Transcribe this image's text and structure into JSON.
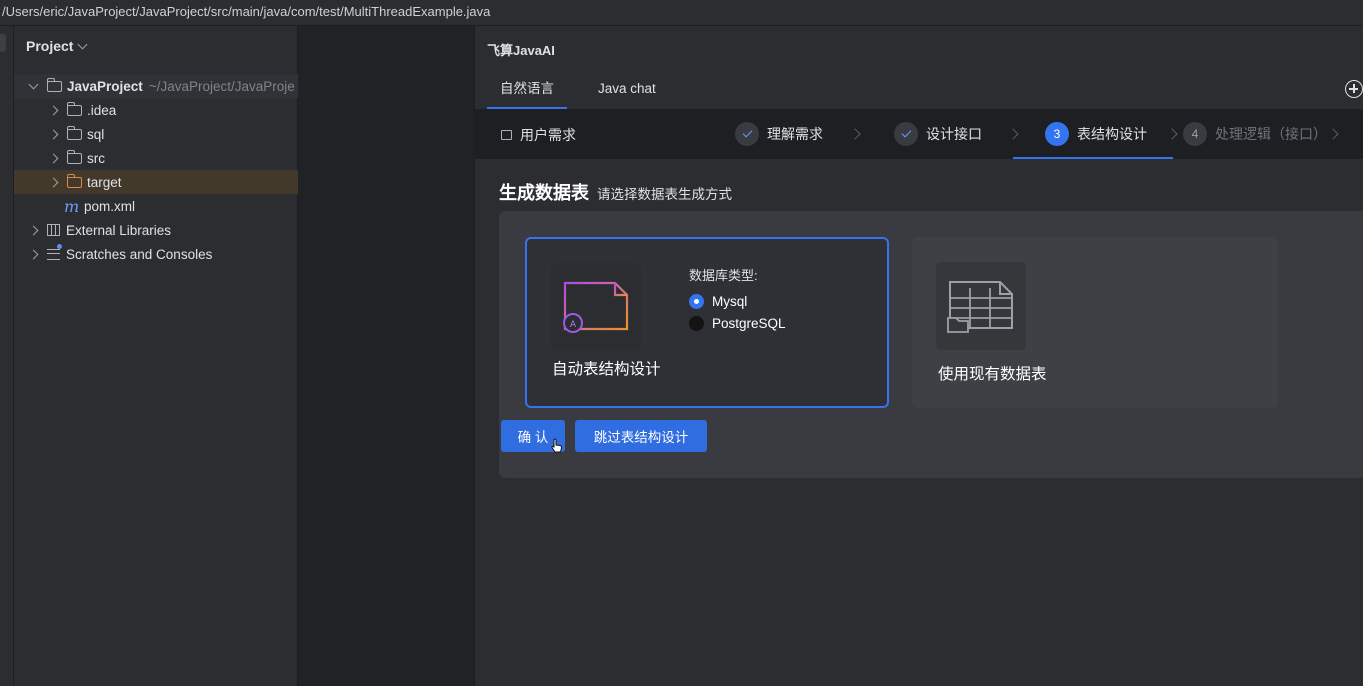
{
  "window": {
    "path": "/Users/eric/JavaProject/JavaProject/src/main/java/com/test/MultiThreadExample.java"
  },
  "project_panel": {
    "title": "Project",
    "tree": [
      {
        "label": "JavaProject",
        "hint": "~/JavaProject/JavaProje",
        "level": 0,
        "expanded": true,
        "icon": "project-folder-icon"
      },
      {
        "label": ".idea",
        "level": 1,
        "icon": "folder-icon"
      },
      {
        "label": "sql",
        "level": 1,
        "icon": "folder-icon"
      },
      {
        "label": "src",
        "level": 1,
        "icon": "folder-icon"
      },
      {
        "label": "target",
        "level": 1,
        "icon": "orange-folder-icon",
        "selected": true
      },
      {
        "label": "pom.xml",
        "level": 1,
        "icon": "maven-icon"
      },
      {
        "label": "External Libraries",
        "level": 0,
        "icon": "library-icon"
      },
      {
        "label": "Scratches and Consoles",
        "level": 0,
        "icon": "scratches-icon"
      }
    ]
  },
  "ai_panel": {
    "title": "飞算JavaAI",
    "tabs": [
      {
        "label": "自然语言",
        "active": true
      },
      {
        "label": "Java chat",
        "active": false
      }
    ],
    "steps": {
      "requirement": "用户需求",
      "items": [
        {
          "label": "理解需求",
          "state": "done",
          "num": ""
        },
        {
          "label": "设计接口",
          "state": "done",
          "num": ""
        },
        {
          "label": "表结构设计",
          "state": "current",
          "num": "3"
        },
        {
          "label": "处理逻辑（接口）",
          "state": "pending",
          "num": "4"
        }
      ]
    },
    "section": {
      "title": "生成数据表",
      "subtitle": "请选择数据表生成方式"
    },
    "cards": {
      "auto": {
        "label": "自动表结构设计",
        "db_type_label": "数据库类型:",
        "options": [
          {
            "label": "Mysql",
            "checked": true
          },
          {
            "label": "PostgreSQL",
            "checked": false
          }
        ]
      },
      "existing": {
        "label": "使用现有数据表"
      }
    },
    "buttons": {
      "confirm": "确 认",
      "skip": "跳过表结构设计"
    }
  },
  "colors": {
    "accent": "#3574f0",
    "selected_row": "#43392a",
    "background": "#2b2d30"
  }
}
